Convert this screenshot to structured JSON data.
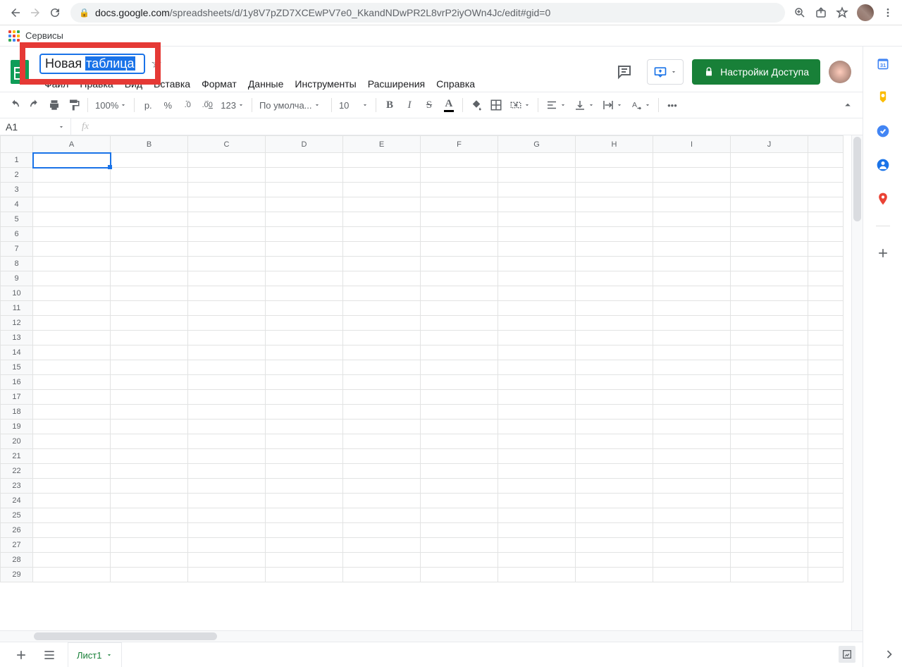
{
  "browser": {
    "url_domain": "docs.google.com",
    "url_path": "/spreadsheets/d/1y8V7pZD7XCEwPV7e0_KkandNDwPR2L8vrP2iyOWn4Jc/edit#gid=0",
    "bookmarks_services": "Сервисы"
  },
  "header": {
    "title_prefix": "Новая ",
    "title_selected": "таблица",
    "share_label": "Настройки Доступа"
  },
  "menu": {
    "file": "Файл",
    "edit": "Правка",
    "view": "Вид",
    "insert": "Вставка",
    "format": "Формат",
    "data": "Данные",
    "tools": "Инструменты",
    "extensions": "Расширения",
    "help": "Справка"
  },
  "toolbar": {
    "zoom": "100%",
    "currency": "р.",
    "percent": "%",
    "dec_less": ".0",
    "dec_more": ".00",
    "num_fmt": "123",
    "font": "По умолча...",
    "font_size": "10",
    "more": "•••"
  },
  "fx": {
    "cell_ref": "A1",
    "fx_label": "fx"
  },
  "columns": [
    "A",
    "B",
    "C",
    "D",
    "E",
    "F",
    "G",
    "H",
    "I",
    "J"
  ],
  "rows": [
    "1",
    "2",
    "3",
    "4",
    "5",
    "6",
    "7",
    "8",
    "9",
    "10",
    "11",
    "12",
    "13",
    "14",
    "15",
    "16",
    "17",
    "18",
    "19",
    "20",
    "21",
    "22",
    "23",
    "24",
    "25",
    "26",
    "27",
    "28",
    "29"
  ],
  "tabs": {
    "sheet1": "Лист1"
  },
  "side_panel": {
    "calendar_day": "31"
  }
}
